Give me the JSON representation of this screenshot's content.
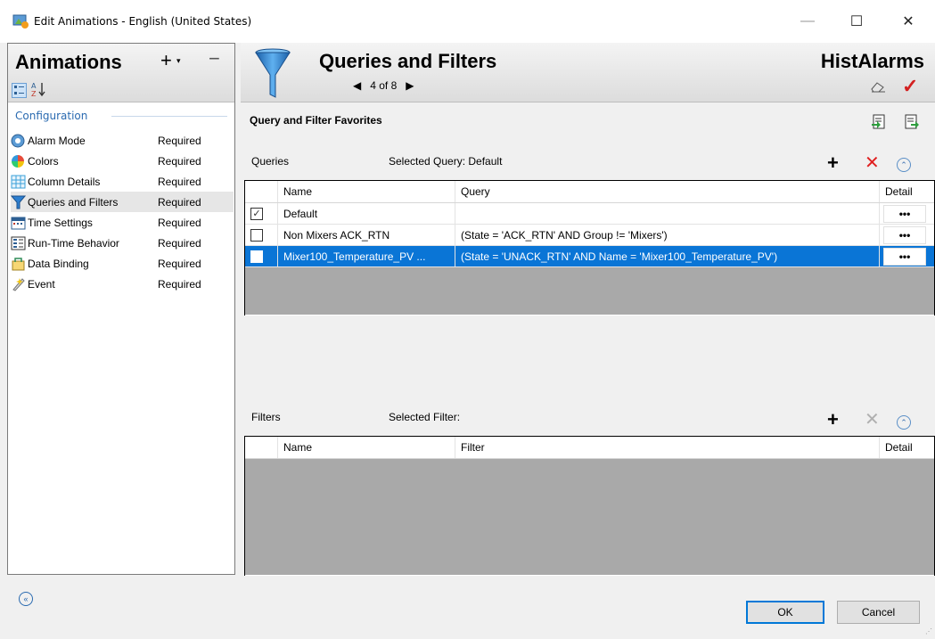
{
  "window": {
    "title": "Edit Animations - English (United States)",
    "minimize": "—",
    "maximize": "☐",
    "close": "✕"
  },
  "left": {
    "title": "Animations",
    "plus": "+",
    "plus_caret": "▾",
    "minus": "−",
    "sort_az": "A↓Z",
    "section": "Configuration",
    "items": [
      {
        "label": "Alarm Mode",
        "status": "Required",
        "icon": "alarm-mode-icon"
      },
      {
        "label": "Colors",
        "status": "Required",
        "icon": "colors-icon"
      },
      {
        "label": "Column Details",
        "status": "Required",
        "icon": "column-details-icon"
      },
      {
        "label": "Queries and Filters",
        "status": "Required",
        "icon": "funnel-icon"
      },
      {
        "label": "Time Settings",
        "status": "Required",
        "icon": "time-settings-icon"
      },
      {
        "label": "Run-Time Behavior",
        "status": "Required",
        "icon": "runtime-behavior-icon"
      },
      {
        "label": "Data Binding",
        "status": "Required",
        "icon": "data-binding-icon"
      },
      {
        "label": "Event",
        "status": "Required",
        "icon": "event-icon"
      }
    ]
  },
  "right": {
    "title": "Queries and Filters",
    "pager": "4 of 8",
    "object": "HistAlarms",
    "favorites": "Query and Filter Favorites",
    "queries": {
      "label": "Queries",
      "selected": "Selected Query: Default",
      "columns": [
        "Name",
        "Query",
        "Detail"
      ],
      "rows": [
        {
          "checked": "✓",
          "name": "Default",
          "query": "",
          "detail": "•••"
        },
        {
          "checked": "",
          "name": "Non Mixers ACK_RTN",
          "query": "(State = 'ACK_RTN' AND Group != 'Mixers')",
          "detail": "•••"
        },
        {
          "checked": "",
          "name": "Mixer100_Temperature_PV ...",
          "query": "(State = 'UNACK_RTN' AND Name = 'Mixer100_Temperature_PV')",
          "detail": "•••"
        }
      ]
    },
    "filters": {
      "label": "Filters",
      "selected": "Selected Filter:",
      "columns": [
        "Name",
        "Filter",
        "Detail"
      ]
    }
  },
  "footer": {
    "ok": "OK",
    "cancel": "Cancel"
  },
  "colors": {
    "selection": "#0a75d6",
    "accent_red": "#d32020",
    "link_blue": "#2a6ab0"
  }
}
